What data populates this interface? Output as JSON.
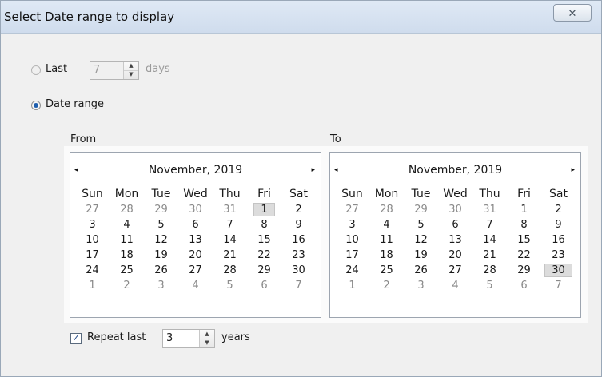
{
  "window": {
    "title": "Select Date range to display",
    "close_glyph": "✕"
  },
  "last_option": {
    "label": "Last",
    "value": "7",
    "unit": "days",
    "selected": false
  },
  "range_option": {
    "label": "Date range",
    "selected": true
  },
  "from": {
    "label": "From",
    "calendar": {
      "prev": "◂",
      "next": "▸",
      "month": "November, 2019",
      "weekdays": [
        "Sun",
        "Mon",
        "Tue",
        "Wed",
        "Thu",
        "Fri",
        "Sat"
      ],
      "weeks": [
        [
          "27",
          "28",
          "29",
          "30",
          "31",
          "1",
          "2"
        ],
        [
          "3",
          "4",
          "5",
          "6",
          "7",
          "8",
          "9"
        ],
        [
          "10",
          "11",
          "12",
          "13",
          "14",
          "15",
          "16"
        ],
        [
          "17",
          "18",
          "19",
          "20",
          "21",
          "22",
          "23"
        ],
        [
          "24",
          "25",
          "26",
          "27",
          "28",
          "29",
          "30"
        ],
        [
          "1",
          "2",
          "3",
          "4",
          "5",
          "6",
          "7"
        ]
      ],
      "selected_day": "1"
    }
  },
  "to": {
    "label": "To",
    "calendar": {
      "prev": "◂",
      "next": "▸",
      "month": "November, 2019",
      "weekdays": [
        "Sun",
        "Mon",
        "Tue",
        "Wed",
        "Thu",
        "Fri",
        "Sat"
      ],
      "weeks": [
        [
          "27",
          "28",
          "29",
          "30",
          "31",
          "1",
          "2"
        ],
        [
          "3",
          "4",
          "5",
          "6",
          "7",
          "8",
          "9"
        ],
        [
          "10",
          "11",
          "12",
          "13",
          "14",
          "15",
          "16"
        ],
        [
          "17",
          "18",
          "19",
          "20",
          "21",
          "22",
          "23"
        ],
        [
          "24",
          "25",
          "26",
          "27",
          "28",
          "29",
          "30"
        ],
        [
          "1",
          "2",
          "3",
          "4",
          "5",
          "6",
          "7"
        ]
      ],
      "selected_day": "30"
    }
  },
  "repeat": {
    "label": "Repeat last",
    "checked": true,
    "check_glyph": "✓",
    "value": "3",
    "unit": "years"
  },
  "spin_glyphs": {
    "up": "▲",
    "down": "▼"
  }
}
